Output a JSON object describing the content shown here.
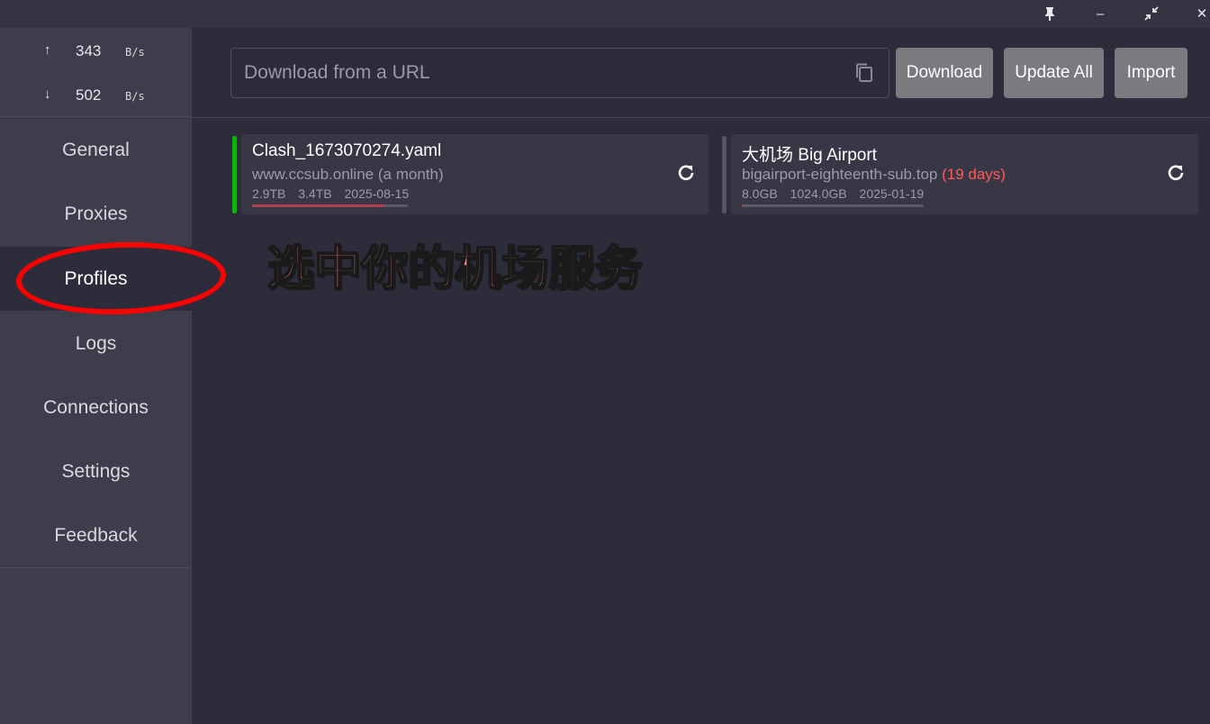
{
  "window": {
    "pin_icon": "pin-icon",
    "minimize_label": "–",
    "restore_icon": "collapse-arrows-icon",
    "close_label": "✕"
  },
  "traffic": {
    "upload": {
      "arrow": "↑",
      "value": "343",
      "unit": "B/s"
    },
    "download": {
      "arrow": "↓",
      "value": "502",
      "unit": "B/s"
    }
  },
  "sidebar": {
    "items": [
      {
        "label": "General"
      },
      {
        "label": "Proxies"
      },
      {
        "label": "Profiles",
        "active": true
      },
      {
        "label": "Logs"
      },
      {
        "label": "Connections"
      },
      {
        "label": "Settings"
      },
      {
        "label": "Feedback"
      }
    ]
  },
  "toolbar": {
    "url_placeholder": "Download from a URL",
    "url_value": "",
    "download_label": "Download",
    "update_all_label": "Update All",
    "import_label": "Import"
  },
  "profiles": [
    {
      "title": "Clash_1673070274.yaml",
      "source": "www.ccsub.online",
      "expiry": "(a month)",
      "used": "2.9TB",
      "total": "3.4TB",
      "date": "2025-08-15",
      "usage_fraction": 0.85,
      "selected": true,
      "indicator_color": "#13b013"
    },
    {
      "title": "大机场 Big Airport",
      "source": "bigairport-eighteenth-sub.top",
      "expiry": "(19 days)",
      "used": "8.0GB",
      "total": "1024.0GB",
      "date": "2025-01-19",
      "usage_fraction": 0.008,
      "selected": false,
      "indicator_color": "#55555f"
    }
  ],
  "annotation": {
    "text": "选中你的机场服务"
  }
}
